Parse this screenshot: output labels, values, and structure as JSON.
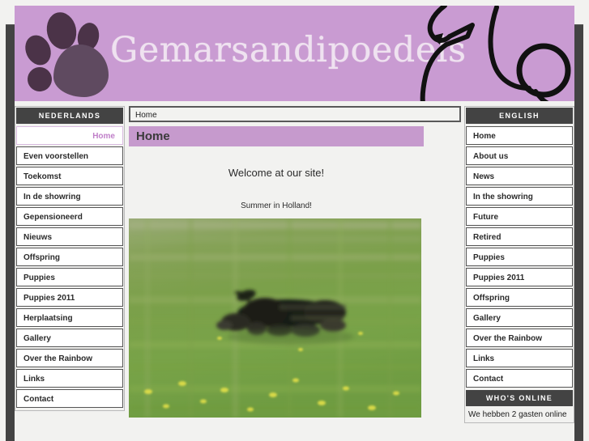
{
  "site": {
    "title": "Gemarsandipoedels",
    "logo_icon": "paw-print-icon",
    "decoration_icon": "poodle-line-art-icon",
    "banner_color": "#c99bd2",
    "accent_color": "#c69acd",
    "dark_color": "#434343"
  },
  "left_menu": {
    "title": "NEDERLANDS",
    "items": [
      {
        "label": "Home",
        "active": true
      },
      {
        "label": "Even voorstellen",
        "active": false
      },
      {
        "label": "Toekomst",
        "active": false
      },
      {
        "label": "In de showring",
        "active": false
      },
      {
        "label": "Gepensioneerd",
        "active": false
      },
      {
        "label": "Nieuws",
        "active": false
      },
      {
        "label": "Offspring",
        "active": false
      },
      {
        "label": "Puppies",
        "active": false
      },
      {
        "label": "Puppies 2011",
        "active": false
      },
      {
        "label": "Herplaatsing",
        "active": false
      },
      {
        "label": "Gallery",
        "active": false
      },
      {
        "label": "Over the Rainbow",
        "active": false
      },
      {
        "label": "Links",
        "active": false
      },
      {
        "label": "Contact",
        "active": false
      }
    ]
  },
  "right_menu": {
    "title": "ENGLISH",
    "items": [
      {
        "label": "Home"
      },
      {
        "label": "About us"
      },
      {
        "label": "News"
      },
      {
        "label": "In the showring"
      },
      {
        "label": "Future"
      },
      {
        "label": "Retired"
      },
      {
        "label": "Puppies"
      },
      {
        "label": "Puppies 2011"
      },
      {
        "label": "Offspring"
      },
      {
        "label": "Gallery"
      },
      {
        "label": "Over the Rainbow"
      },
      {
        "label": "Links"
      },
      {
        "label": "Contact"
      }
    ],
    "who_online": {
      "title": "WHO'S ONLINE",
      "text": "We hebben 2 gasten online"
    }
  },
  "main": {
    "breadcrumb": "Home",
    "heading": "Home",
    "welcome": "Welcome at our site!",
    "caption": "Summer in Holland!",
    "photo_alt": "black poodle running through a green meadow with dandelions"
  }
}
